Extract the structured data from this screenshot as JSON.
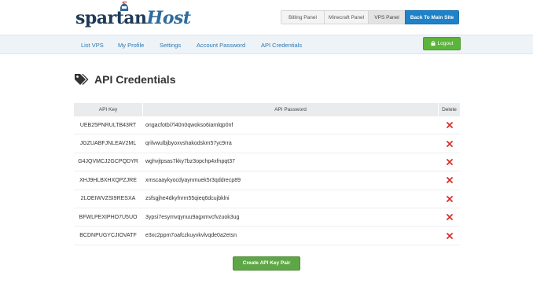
{
  "brand": {
    "name_part1": "spartan",
    "name_part2": "Host"
  },
  "top_tabs": {
    "billing": "Billing Panel",
    "minecraft": "Minecraft Panel",
    "vps": "VPS Panel",
    "main_site": "Back To Main Site"
  },
  "nav": {
    "list_vps": "List VPS",
    "my_profile": "My Profile",
    "settings": "Settings",
    "account_password": "Account Password",
    "api_credentials": "API Credentials",
    "logout": "Logout"
  },
  "page": {
    "title": "API Credentials"
  },
  "table": {
    "headers": {
      "key": "API Key",
      "password": "API Password",
      "delete": "Delete"
    },
    "rows": [
      {
        "key": "UEB25PNRULTB43RT",
        "password": "ongacfotbi7l40n0qwokso6iamlqp0nf"
      },
      {
        "key": "JGZUABFJNLEAV2ML",
        "password": "qrilvwulbjbyoxvshakodskm57yc9rra"
      },
      {
        "key": "G4JQVMCJ2GCPQDYR",
        "password": "wghvjtpsas7kky7bz3opchp4xfnpqt37"
      },
      {
        "key": "XHJ9HLBXHXQPZJRE",
        "password": "xmscaaykyocdyaynmuek5r3qddrecp89"
      },
      {
        "key": "2LOEIWVZSI9RESXA",
        "password": "zsfsgjhe4dkyfnrm55qieq6dcujbklni"
      },
      {
        "key": "BFWLPEXIPHO7U5UO",
        "password": "3ypsi7esymvqynuu9agxmvcfvzuok3ug"
      },
      {
        "key": "BCDNPUGYCJIOVATF",
        "password": "e3xc2ppm7oafczkuyvkvlvqde0a2etsn"
      }
    ]
  },
  "create_button": "Create API Key Pair",
  "colors": {
    "accent_blue": "#1f82c9",
    "nav_link": "#2b78b5",
    "green": "#5bb53a",
    "delete_red": "#d9312c"
  }
}
